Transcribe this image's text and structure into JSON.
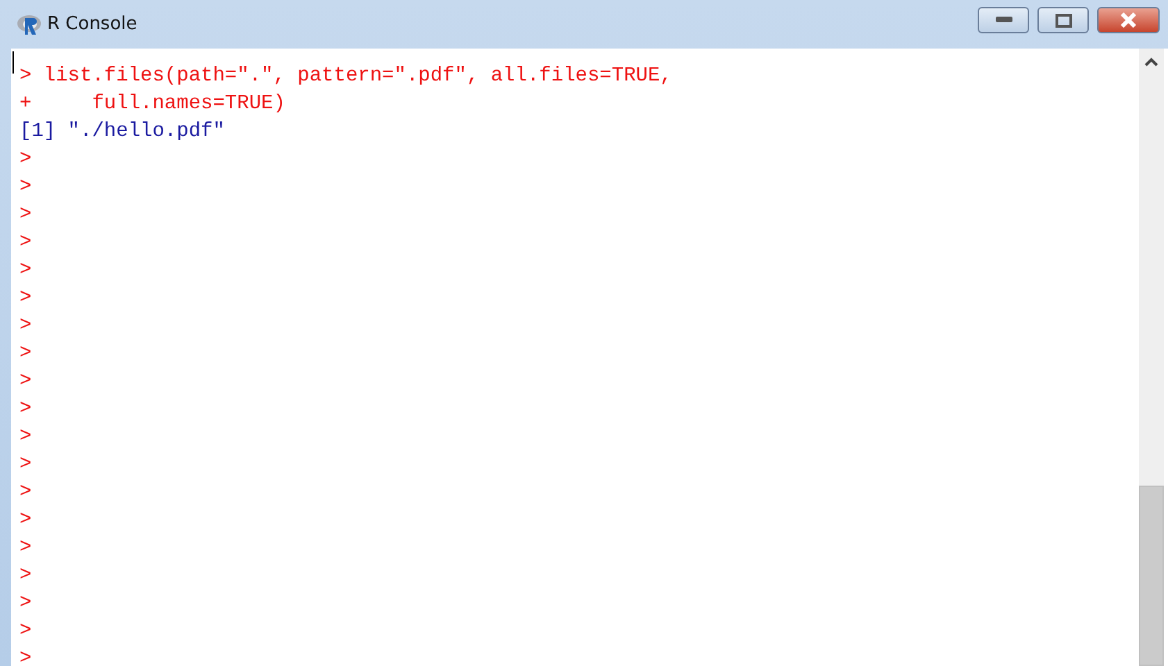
{
  "window": {
    "title": "R Console"
  },
  "console": {
    "lines": [
      {
        "kind": "input",
        "text": "> list.files(path=\".\", pattern=\".pdf\", all.files=TRUE,"
      },
      {
        "kind": "input",
        "text": "+     full.names=TRUE)"
      },
      {
        "kind": "output",
        "text": "[1] \"./hello.pdf\""
      },
      {
        "kind": "input",
        "text": ">"
      },
      {
        "kind": "input",
        "text": ">"
      },
      {
        "kind": "input",
        "text": ">"
      },
      {
        "kind": "input",
        "text": ">"
      },
      {
        "kind": "input",
        "text": ">"
      },
      {
        "kind": "input",
        "text": ">"
      },
      {
        "kind": "input",
        "text": ">"
      },
      {
        "kind": "input",
        "text": ">"
      },
      {
        "kind": "input",
        "text": ">"
      },
      {
        "kind": "input",
        "text": ">"
      },
      {
        "kind": "input",
        "text": ">"
      },
      {
        "kind": "input",
        "text": ">"
      },
      {
        "kind": "input",
        "text": ">"
      },
      {
        "kind": "input",
        "text": ">"
      },
      {
        "kind": "input",
        "text": ">"
      },
      {
        "kind": "input",
        "text": ">"
      },
      {
        "kind": "input",
        "text": ">"
      },
      {
        "kind": "input",
        "text": ">"
      },
      {
        "kind": "input",
        "text": ">"
      }
    ]
  }
}
